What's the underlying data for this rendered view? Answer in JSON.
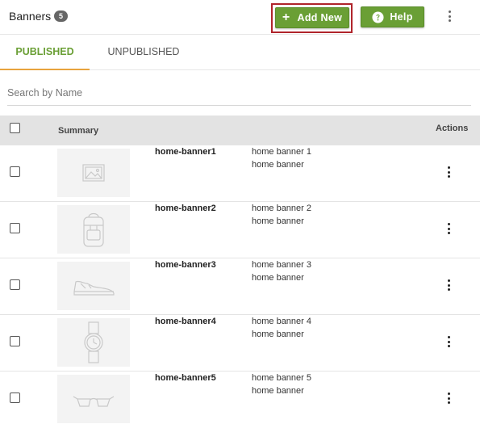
{
  "header": {
    "title": "Banners",
    "count": "5",
    "add_new_label": "Add New",
    "help_label": "Help"
  },
  "tabs": [
    {
      "label": "PUBLISHED",
      "active": true
    },
    {
      "label": "UNPUBLISHED",
      "active": false
    }
  ],
  "search": {
    "placeholder": "Search by Name"
  },
  "table": {
    "columns": {
      "summary": "Summary",
      "actions": "Actions"
    },
    "rows": [
      {
        "name": "home-banner1",
        "line1": "home banner 1",
        "line2": "home banner",
        "thumbnail": "picture-icon"
      },
      {
        "name": "home-banner2",
        "line1": "home banner 2",
        "line2": "home banner",
        "thumbnail": "backpack-icon"
      },
      {
        "name": "home-banner3",
        "line1": "home banner 3",
        "line2": "home banner",
        "thumbnail": "sneaker-icon"
      },
      {
        "name": "home-banner4",
        "line1": "home banner 4",
        "line2": "home banner",
        "thumbnail": "wristwatch-icon"
      },
      {
        "name": "home-banner5",
        "line1": "home banner 5",
        "line2": "home banner",
        "thumbnail": "sunglasses-icon"
      }
    ]
  },
  "colors": {
    "accent_green": "#6a9f35",
    "tab_underline": "#e8a33d",
    "highlight_outline": "#b0242b"
  }
}
